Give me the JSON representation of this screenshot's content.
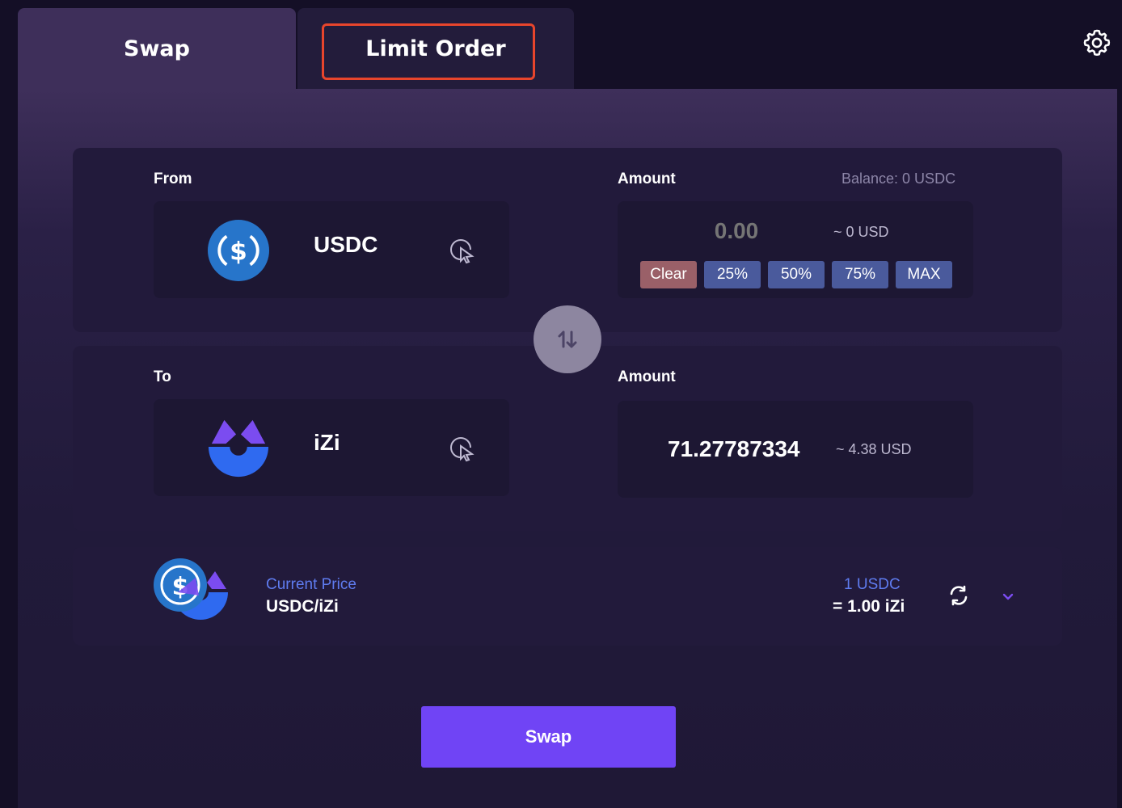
{
  "tabs": {
    "swap": "Swap",
    "limit_order": "Limit Order",
    "active": "Swap",
    "highlighted": "Limit Order"
  },
  "from": {
    "label": "From",
    "token": "USDC",
    "amount_label": "Amount",
    "balance": "Balance: 0 USDC",
    "amount_placeholder": "0.00",
    "usd_value": "~ 0 USD",
    "buttons": {
      "clear": "Clear",
      "p25": "25%",
      "p50": "50%",
      "p75": "75%",
      "max": "MAX"
    }
  },
  "to": {
    "label": "To",
    "token": "iZi",
    "amount_label": "Amount",
    "amount": "71.27787334",
    "usd_value": "~ 4.38 USD"
  },
  "price": {
    "title": "Current Price",
    "pair": "USDC/iZi",
    "rate_top": "1 USDC",
    "rate_bottom": "= 1.00 iZi"
  },
  "swap_button": "Swap",
  "icons": {
    "settings": "gear-icon",
    "usdc": "usdc-token-icon",
    "izi": "izi-token-icon",
    "select": "cursor-select-icon",
    "swap_direction": "swap-arrows-icon",
    "refresh": "refresh-icon",
    "expand": "chevron-down-icon"
  },
  "colors": {
    "background": "#140f26",
    "panel": "#221a3b",
    "accent": "#7044f5",
    "highlight_border": "#e8452c",
    "price_blue": "#5f7cf0",
    "usdc_blue": "#2775ca",
    "izi_purple": "#7b4cf0",
    "izi_blue": "#2f6af0"
  }
}
